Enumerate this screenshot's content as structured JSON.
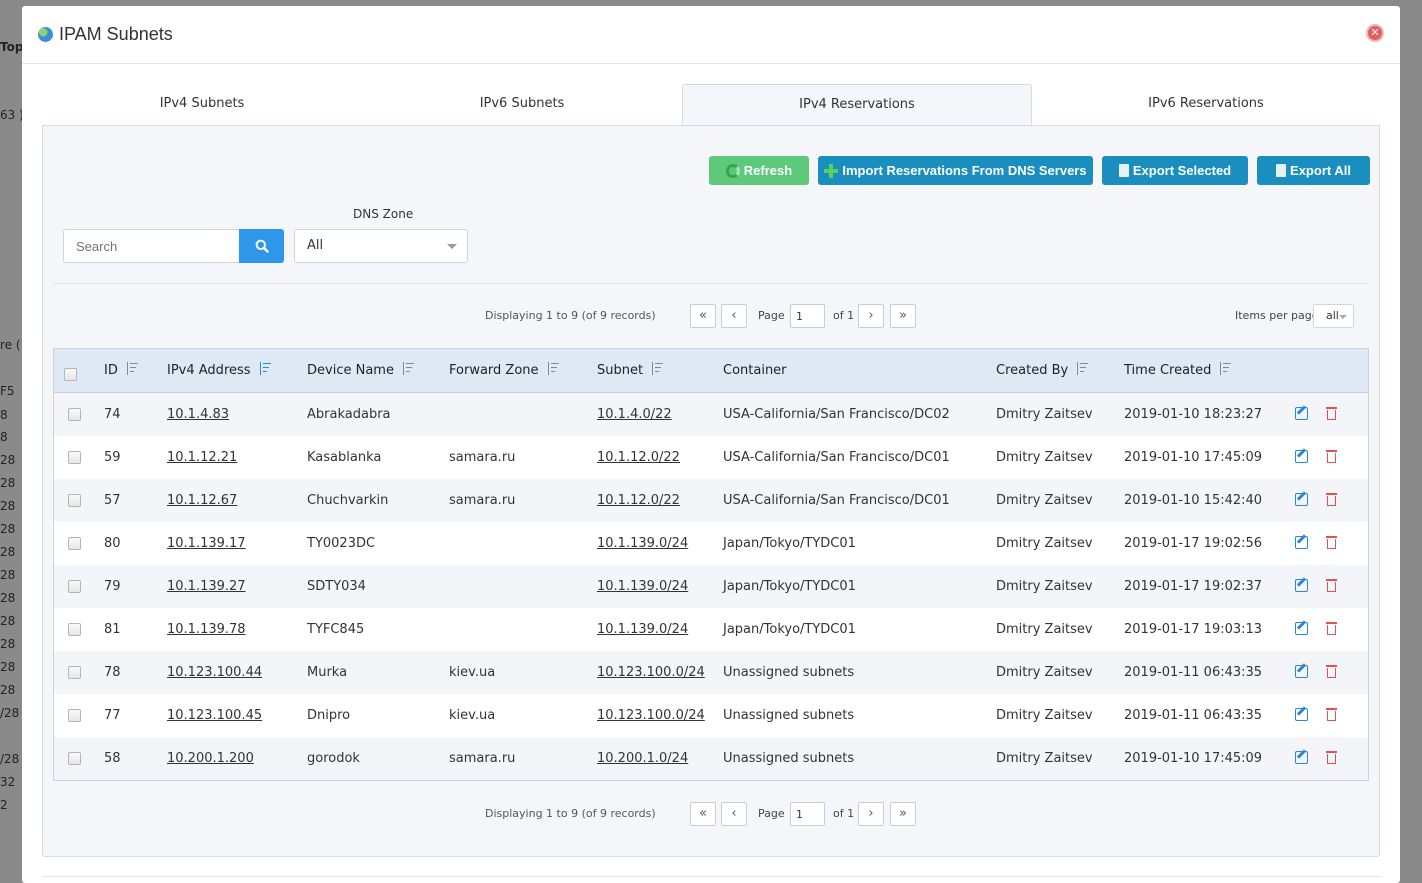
{
  "backdrop": [
    "Top",
    "63 )",
    "re (",
    "F5",
    "8",
    "8",
    "28",
    "28",
    "28",
    "28",
    "28",
    "28",
    "28",
    "28",
    "28",
    "28",
    "28",
    "/28",
    "/28",
    "32",
    "2"
  ],
  "modal": {
    "title": "IPAM Subnets"
  },
  "tabs": [
    {
      "label": "IPv4 Subnets",
      "active": false
    },
    {
      "label": "IPv6 Subnets",
      "active": false
    },
    {
      "label": "IPv4 Reservations",
      "active": true
    },
    {
      "label": "IPv6 Reservations",
      "active": false
    }
  ],
  "toolbar": {
    "refresh": "Refresh",
    "import": "Import Reservations From DNS Servers",
    "export_selected": "Export Selected",
    "export_all": "Export All"
  },
  "filters": {
    "search_placeholder": "Search",
    "dns_zone_label": "DNS Zone",
    "dns_zone_value": "All"
  },
  "pager": {
    "info": "Displaying 1 to 9 (of 9 records)",
    "first": "«",
    "prev": "‹",
    "next": "›",
    "last": "»",
    "page_label": "Page",
    "page_value": "1",
    "of_label": "of 1",
    "items_per_page_label": "Items per page",
    "items_per_page_value": "all"
  },
  "table": {
    "columns": [
      "ID",
      "IPv4 Address",
      "Device Name",
      "Forward Zone",
      "Subnet",
      "Container",
      "Created By",
      "Time Created"
    ],
    "rows": [
      {
        "id": "74",
        "ip": "10.1.4.83",
        "device": "Abrakadabra",
        "zone": "",
        "subnet": "10.1.4.0/22",
        "container": "USA-California/San Francisco/DC02",
        "created_by": "Dmitry Zaitsev",
        "time": "2019-01-10 18:23:27"
      },
      {
        "id": "59",
        "ip": "10.1.12.21",
        "device": "Kasablanka",
        "zone": "samara.ru",
        "subnet": "10.1.12.0/22",
        "container": "USA-California/San Francisco/DC01",
        "created_by": "Dmitry Zaitsev",
        "time": "2019-01-10 17:45:09"
      },
      {
        "id": "57",
        "ip": "10.1.12.67",
        "device": "Chuchvarkin",
        "zone": "samara.ru",
        "subnet": "10.1.12.0/22",
        "container": "USA-California/San Francisco/DC01",
        "created_by": "Dmitry Zaitsev",
        "time": "2019-01-10 15:42:40"
      },
      {
        "id": "80",
        "ip": "10.1.139.17",
        "device": "TY0023DC",
        "zone": "",
        "subnet": "10.1.139.0/24",
        "container": "Japan/Tokyo/TYDC01",
        "created_by": "Dmitry Zaitsev",
        "time": "2019-01-17 19:02:56"
      },
      {
        "id": "79",
        "ip": "10.1.139.27",
        "device": "SDTY034",
        "zone": "",
        "subnet": "10.1.139.0/24",
        "container": "Japan/Tokyo/TYDC01",
        "created_by": "Dmitry Zaitsev",
        "time": "2019-01-17 19:02:37"
      },
      {
        "id": "81",
        "ip": "10.1.139.78",
        "device": "TYFC845",
        "zone": "",
        "subnet": "10.1.139.0/24",
        "container": "Japan/Tokyo/TYDC01",
        "created_by": "Dmitry Zaitsev",
        "time": "2019-01-17 19:03:13"
      },
      {
        "id": "78",
        "ip": "10.123.100.44",
        "device": "Murka",
        "zone": "kiev.ua",
        "subnet": "10.123.100.0/24",
        "container": "Unassigned subnets",
        "created_by": "Dmitry Zaitsev",
        "time": "2019-01-11 06:43:35"
      },
      {
        "id": "77",
        "ip": "10.123.100.45",
        "device": "Dnipro",
        "zone": "kiev.ua",
        "subnet": "10.123.100.0/24",
        "container": "Unassigned subnets",
        "created_by": "Dmitry Zaitsev",
        "time": "2019-01-11 06:43:35"
      },
      {
        "id": "58",
        "ip": "10.200.1.200",
        "device": "gorodok",
        "zone": "samara.ru",
        "subnet": "10.200.1.0/24",
        "container": "Unassigned subnets",
        "created_by": "Dmitry Zaitsev",
        "time": "2019-01-10 17:45:09"
      }
    ]
  }
}
